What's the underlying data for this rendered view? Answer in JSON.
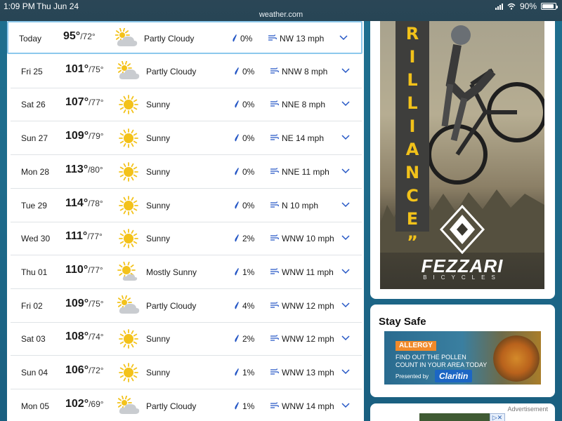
{
  "status_bar": {
    "time": "1:09 PM",
    "date": "Thu Jun 24",
    "url": "weather.com",
    "battery": "90%",
    "battery_level": 0.9
  },
  "colors": {
    "accent_blue": "#2456c5",
    "selected_border": "#8cc8ec",
    "sun_yellow": "#f3c21b",
    "cloud_gray": "#c9ccd0"
  },
  "forecast": [
    {
      "day": "Today",
      "hi": "95°",
      "lo": "/72°",
      "condition": "Partly Cloudy",
      "icon": "partly-cloudy",
      "precip": "0%",
      "wind": "NW 13 mph"
    },
    {
      "day": "Fri 25",
      "hi": "101°",
      "lo": "/75°",
      "condition": "Partly Cloudy",
      "icon": "partly-cloudy",
      "precip": "0%",
      "wind": "NNW 8 mph"
    },
    {
      "day": "Sat 26",
      "hi": "107°",
      "lo": "/77°",
      "condition": "Sunny",
      "icon": "sunny",
      "precip": "0%",
      "wind": "NNE 8 mph"
    },
    {
      "day": "Sun 27",
      "hi": "109°",
      "lo": "/79°",
      "condition": "Sunny",
      "icon": "sunny",
      "precip": "0%",
      "wind": "NE 14 mph"
    },
    {
      "day": "Mon 28",
      "hi": "113°",
      "lo": "/80°",
      "condition": "Sunny",
      "icon": "sunny",
      "precip": "0%",
      "wind": "NNE 11 mph"
    },
    {
      "day": "Tue 29",
      "hi": "114°",
      "lo": "/78°",
      "condition": "Sunny",
      "icon": "sunny",
      "precip": "0%",
      "wind": "N 10 mph"
    },
    {
      "day": "Wed 30",
      "hi": "111°",
      "lo": "/77°",
      "condition": "Sunny",
      "icon": "sunny",
      "precip": "2%",
      "wind": "WNW 10 mph"
    },
    {
      "day": "Thu 01",
      "hi": "110°",
      "lo": "/77°",
      "condition": "Mostly Sunny",
      "icon": "mostly-sunny",
      "precip": "1%",
      "wind": "WNW 11 mph"
    },
    {
      "day": "Fri 02",
      "hi": "109°",
      "lo": "/75°",
      "condition": "Partly Cloudy",
      "icon": "partly-cloudy",
      "precip": "4%",
      "wind": "WNW 12 mph"
    },
    {
      "day": "Sat 03",
      "hi": "108°",
      "lo": "/74°",
      "condition": "Sunny",
      "icon": "sunny",
      "precip": "2%",
      "wind": "WNW 12 mph"
    },
    {
      "day": "Sun 04",
      "hi": "106°",
      "lo": "/72°",
      "condition": "Sunny",
      "icon": "sunny",
      "precip": "1%",
      "wind": "WNW 13 mph"
    },
    {
      "day": "Mon 05",
      "hi": "102°",
      "lo": "/69°",
      "condition": "Partly Cloudy",
      "icon": "partly-cloudy",
      "precip": "1%",
      "wind": "WNW 14 mph"
    }
  ],
  "ad_bike": {
    "vertical_text": "RILLIANCE”",
    "brand": "FEZZARI",
    "sub": "BICYCLES"
  },
  "stay_safe": {
    "title": "Stay Safe",
    "tag": "ALLERGY",
    "line1": "FIND OUT THE POLLEN",
    "line2": "COUNT IN YOUR AREA TODAY",
    "presented": "Presented by",
    "sponsor": "Claritin"
  },
  "bottom_ad": {
    "label": "Advertisement"
  }
}
